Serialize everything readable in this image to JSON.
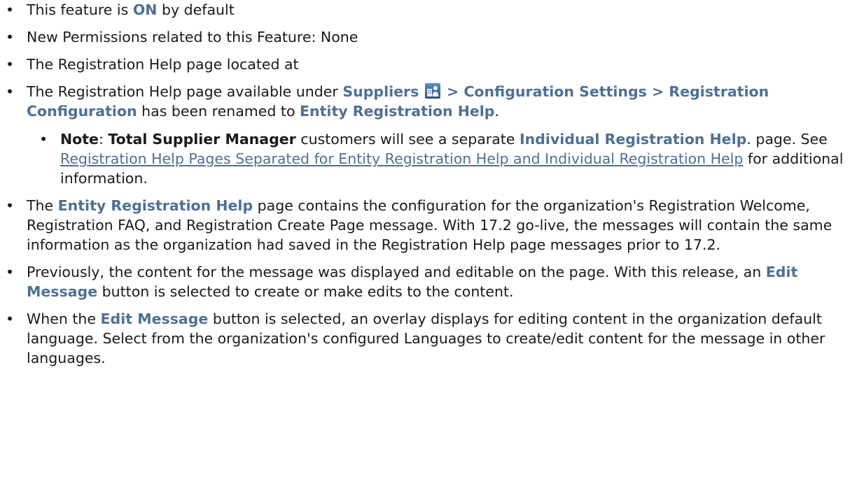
{
  "items": [
    {
      "pre": "This feature is ",
      "hl": "ON",
      "post": " by default"
    },
    {
      "text": "New Permissions related to this Feature: None"
    },
    {
      "text": "The Registration Help page located at"
    },
    {
      "pre": "The Registration Help page available under ",
      "suppliers": "Suppliers",
      "icon": "suppliers-icon",
      "path": " > Configuration Settings > Registration Configuration",
      "mid": " has been renamed to ",
      "target": "Entity Registration Help",
      "end": ".",
      "sub": {
        "note_label": "Note",
        "colon": ": ",
        "product": "Total Supplier Manager",
        "mid": " customers will see a separate ",
        "page_name": "Individual Registration Help",
        "mid2": ". page. See ",
        "link": "Registration Help Pages Separated for Entity Registration Help and Individual Registration Help",
        "end": " for additional information."
      }
    },
    {
      "pre": "The ",
      "hl": "Entity Registration Help",
      "post": " page contains the configuration for the organization's Registration Welcome, Registration FAQ, and Registration Create Page message. With 17.2 go-live, the messages will contain the same information as the organization had saved in the Registration Help page messages prior to 17.2."
    },
    {
      "pre": "Previously, the content for the message was displayed and editable on the page. With this release, an ",
      "hl": "Edit Message",
      "post": " button is selected to create or make edits to the content."
    },
    {
      "pre": "When the ",
      "hl": "Edit Message",
      "post": " button is selected, an overlay displays for editing content in the organization default language. Select from the organization's configured Languages to create/edit content for the message in other languages."
    }
  ],
  "colors": {
    "highlight": "#4f7093",
    "text": "#1a1a1a"
  }
}
